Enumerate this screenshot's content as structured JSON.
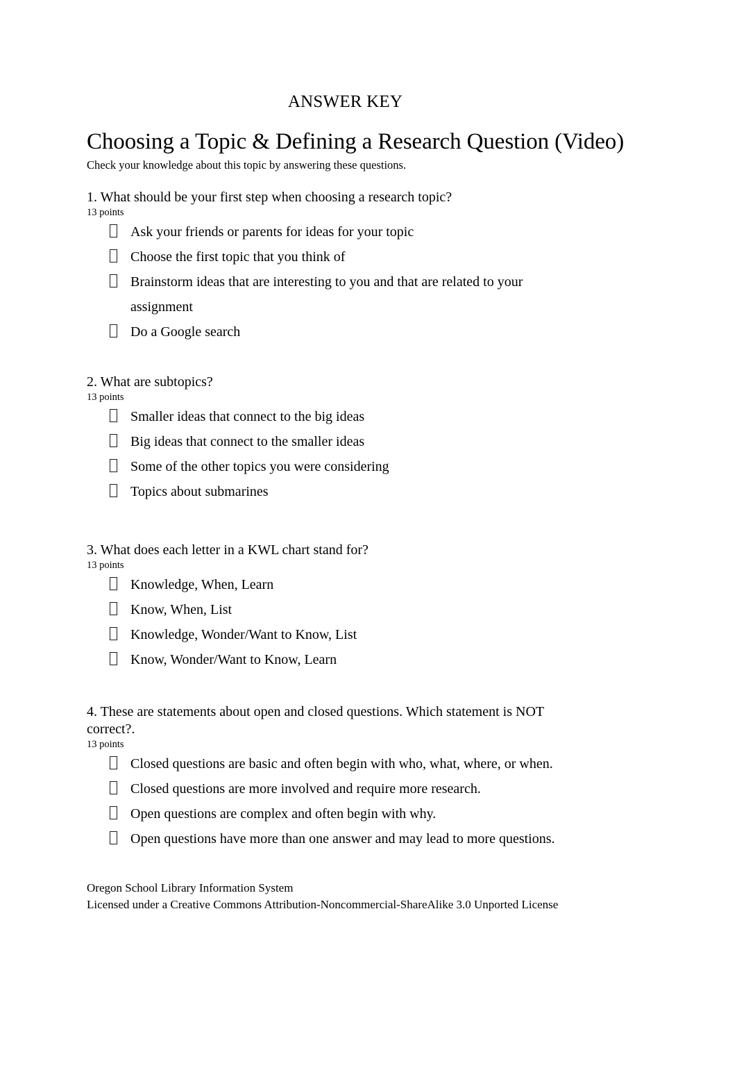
{
  "document": {
    "answer_key_label": "ANSWER KEY",
    "title": "Choosing a Topic & Defining a Research Question (Video)",
    "subtitle": "Check your knowledge about this topic by answering these questions.",
    "bullet_glyph": "missing-glyph-box",
    "text_color": "#000000",
    "background_color": "#ffffff"
  },
  "questions": [
    {
      "number": "1.",
      "text": "1. What should be your first step when choosing a research topic?",
      "points": "13 points",
      "answers": [
        "Ask your friends or parents for ideas for your topic",
        "Choose the first topic that you think of",
        "Brainstorm ideas that are interesting to you and that are related to your assignment",
        "Do a Google search"
      ]
    },
    {
      "number": "2.",
      "text": "2. What are subtopics?",
      "points": "13 points",
      "answers": [
        "Smaller ideas that connect to the big ideas",
        "Big ideas that connect to the smaller ideas",
        "Some of the other topics you were considering",
        "Topics about submarines"
      ]
    },
    {
      "number": "3.",
      "text": "3. What does each letter in a KWL chart stand for?",
      "points": "13 points",
      "answers": [
        "Knowledge, When, Learn",
        "Know, When, List",
        "Knowledge, Wonder/Want to Know, List",
        "Know, Wonder/Want to Know, Learn"
      ]
    },
    {
      "number": "4.",
      "text": "4. These are statements about open and closed questions. Which statement is NOT correct?.",
      "points": "13 points",
      "answers": [
        "Closed questions are basic and often begin with who, what, where, or when.",
        "Closed questions are more involved and require more research.",
        "Open questions are complex and often begin with why.",
        "Open questions have more than one answer and may lead to more questions."
      ]
    }
  ],
  "footer": {
    "organization": "Oregon School Library Information System",
    "license": "Licensed under a Creative Commons Attribution-Noncommercial-ShareAlike 3.0 Unported License"
  }
}
